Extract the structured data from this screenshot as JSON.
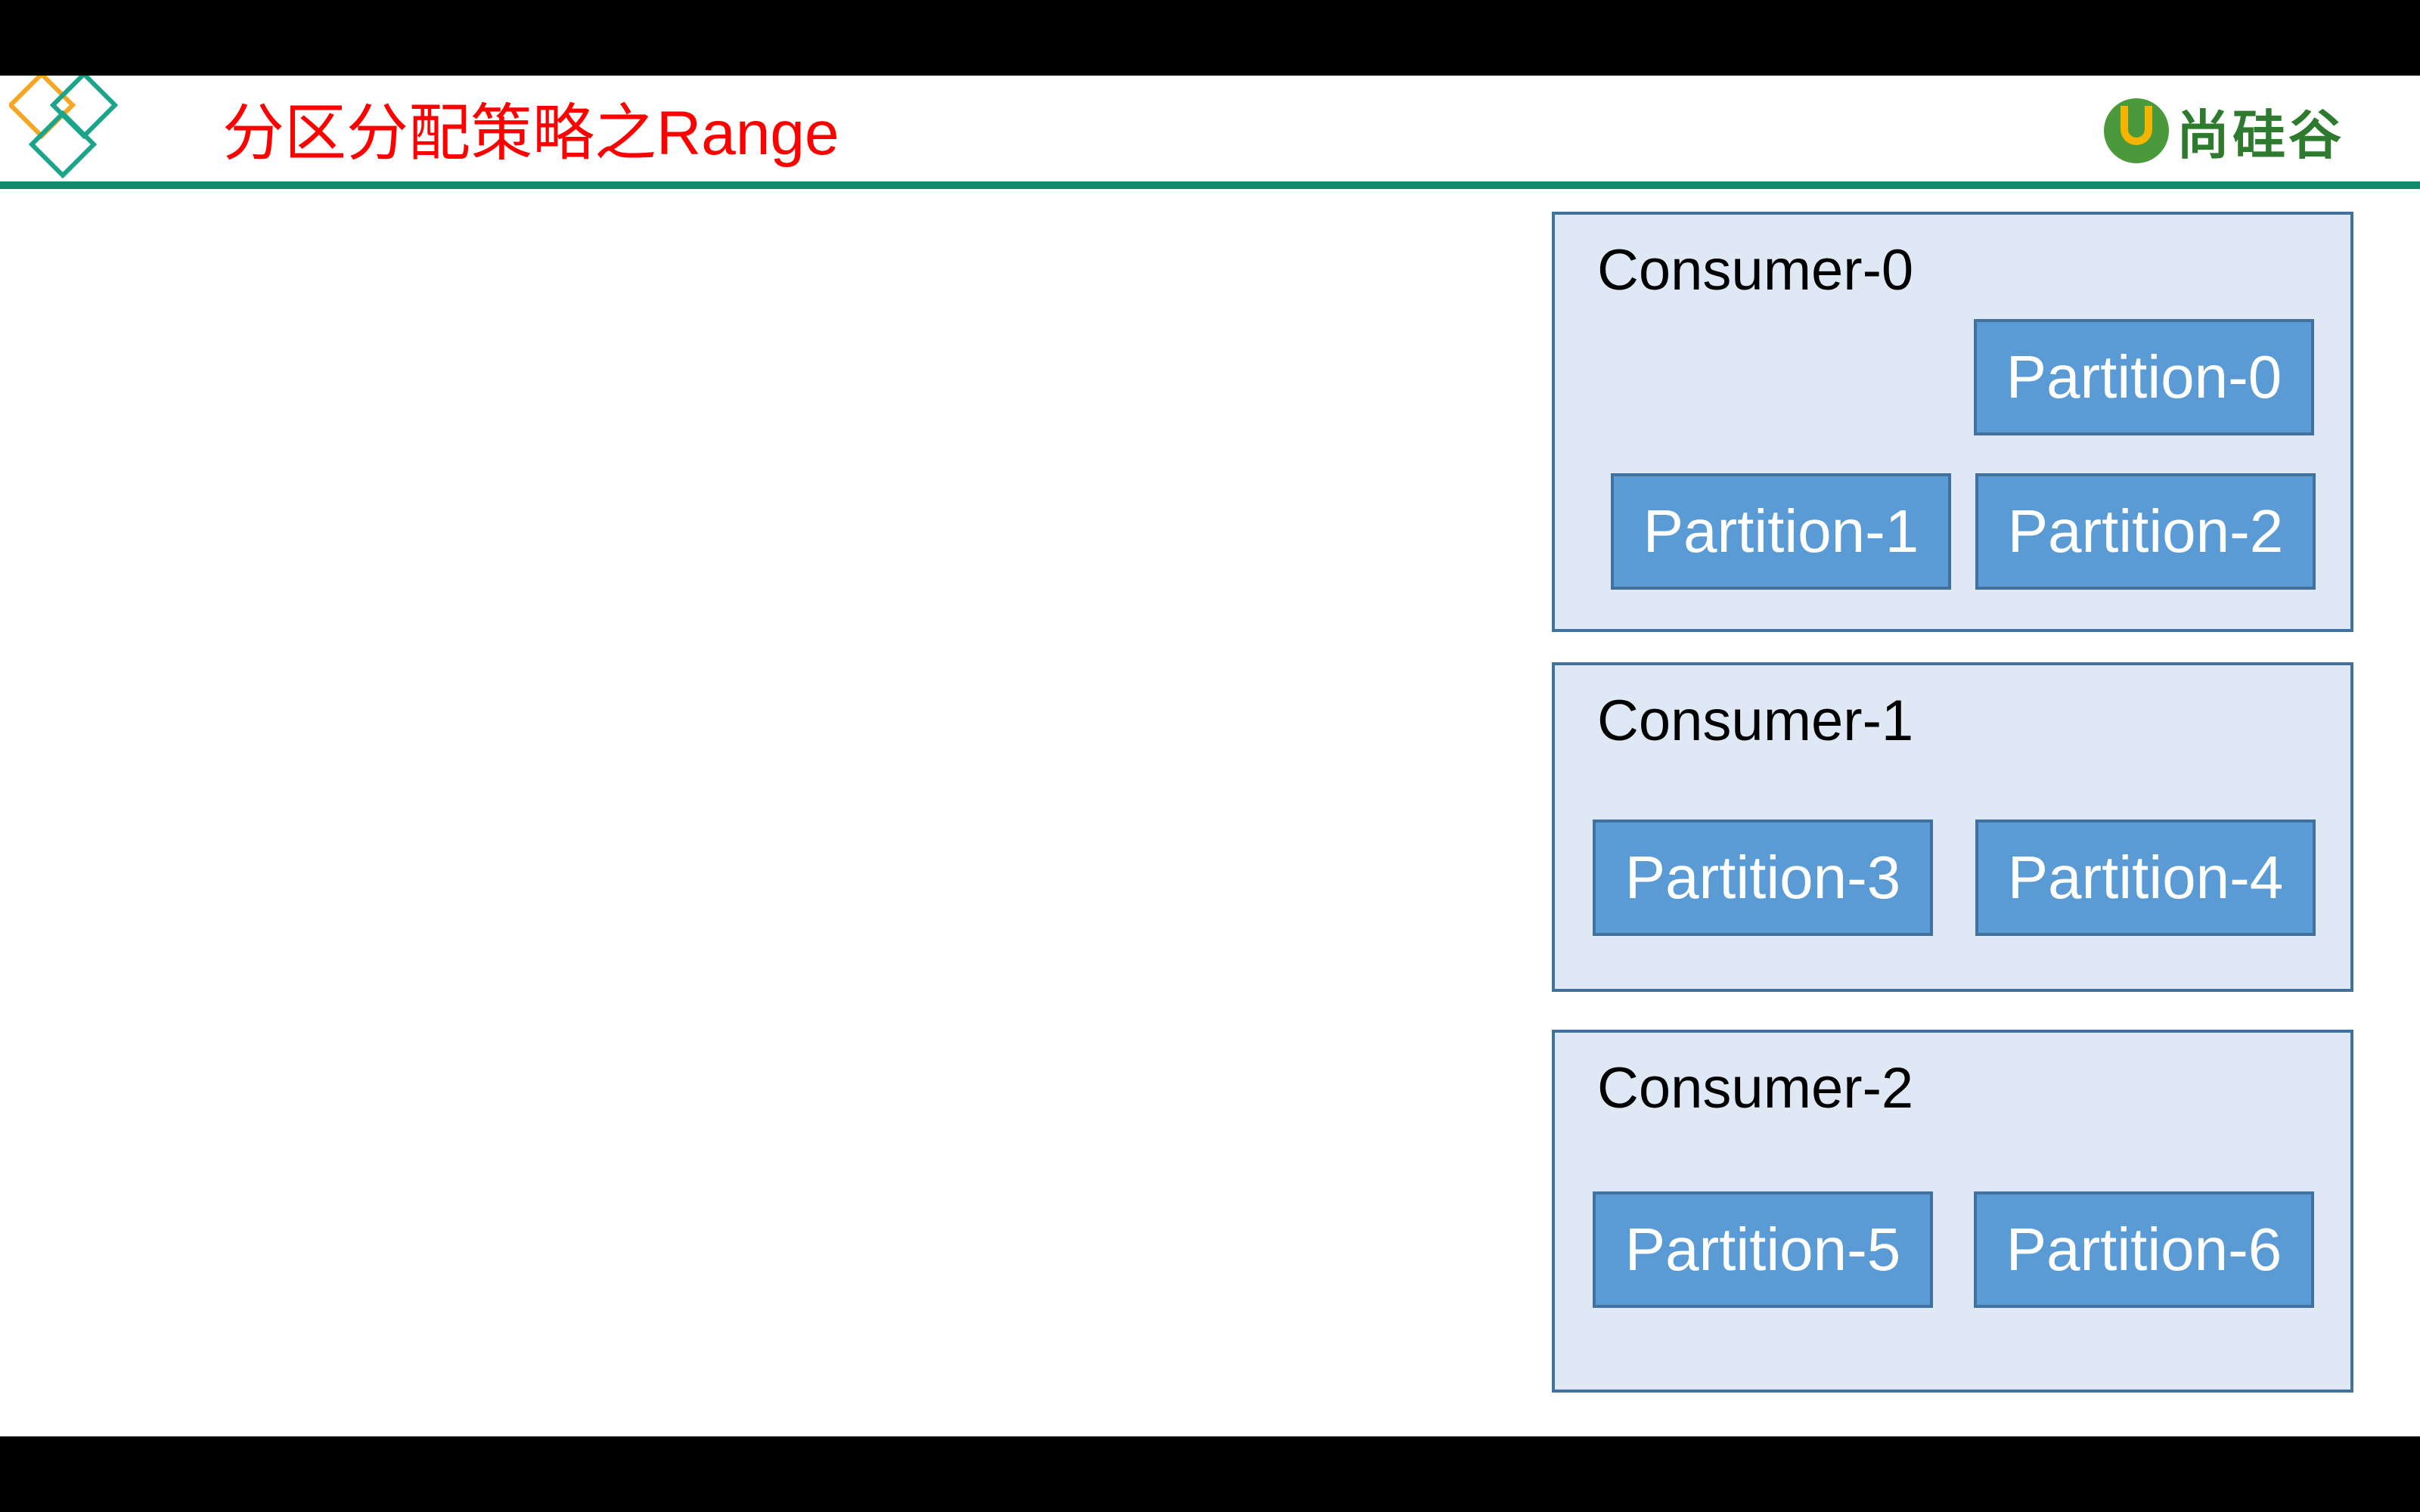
{
  "header": {
    "title": "分区分配策略之Range",
    "brand_name": "尚硅谷"
  },
  "colors": {
    "title": "#ff0000",
    "header_rule": "#138a6d",
    "consumer_fill": "#dee9f5",
    "consumer_border": "#41719c",
    "partition_fill": "#5b9bd5",
    "partition_text": "#ffffff"
  },
  "consumers": [
    {
      "label": "Consumer-0",
      "partitions": [
        "Partition-0",
        "Partition-1",
        "Partition-2"
      ]
    },
    {
      "label": "Consumer-1",
      "partitions": [
        "Partition-3",
        "Partition-4"
      ]
    },
    {
      "label": "Consumer-2",
      "partitions": [
        "Partition-5",
        "Partition-6"
      ]
    }
  ]
}
